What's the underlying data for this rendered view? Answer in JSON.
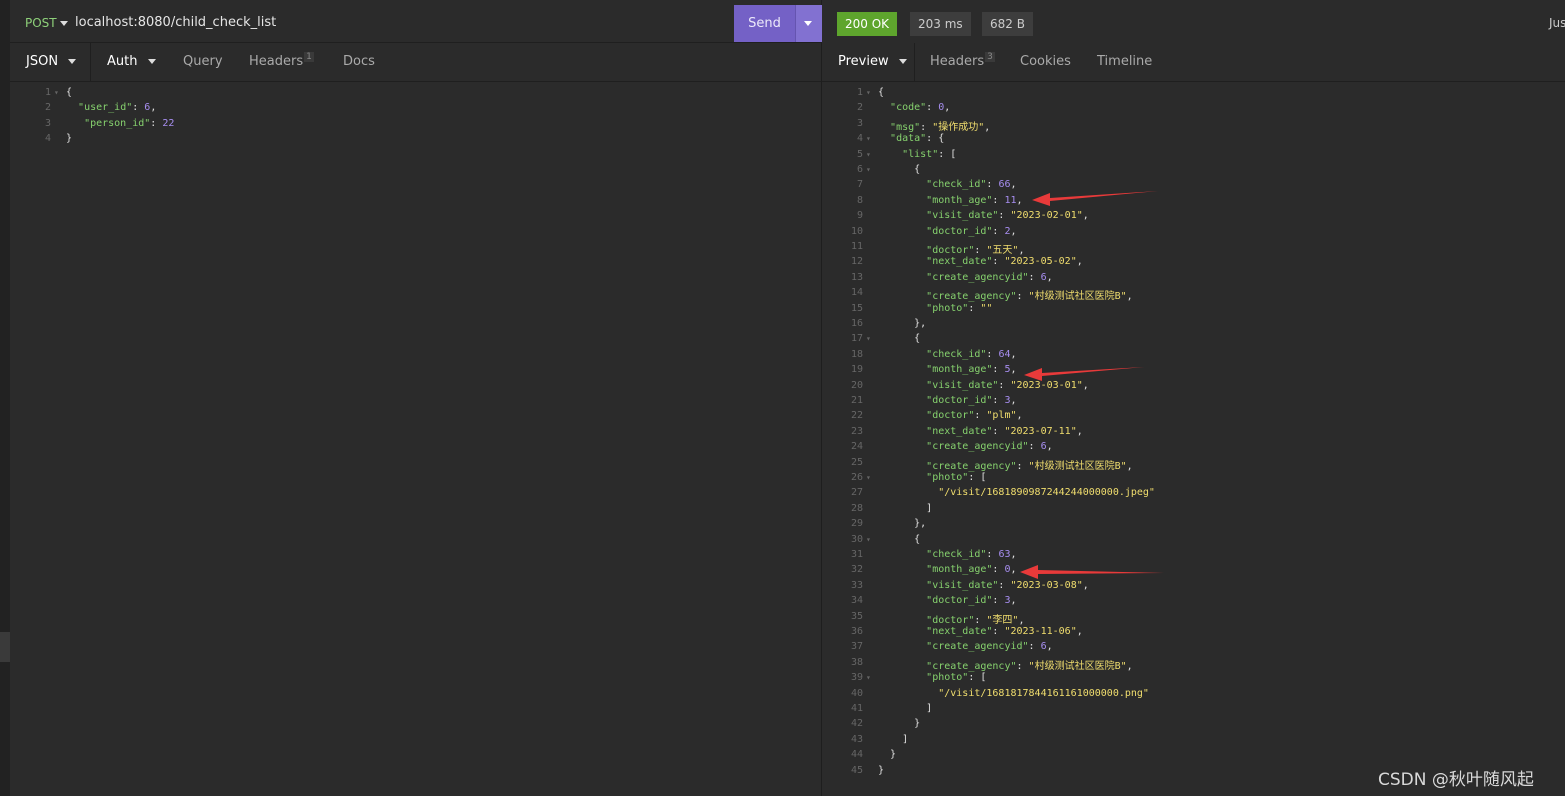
{
  "request": {
    "method": "POST",
    "url": "localhost:8080/child_check_list",
    "send_label": "Send",
    "tabs": {
      "json": "JSON",
      "auth": "Auth",
      "query": "Query",
      "headers": "Headers",
      "headers_count": "1",
      "docs": "Docs"
    },
    "body_lines": [
      "{",
      "  \"user_id\": 6,",
      "   \"person_id\": 22",
      "}"
    ]
  },
  "response": {
    "status": "200 OK",
    "time": "203 ms",
    "size": "682 B",
    "truncated_label": "Jus",
    "tabs": {
      "preview": "Preview",
      "headers": "Headers",
      "headers_count": "3",
      "cookies": "Cookies",
      "timeline": "Timeline"
    },
    "body_lines": [
      "{",
      "  \"code\": 0,",
      "  \"msg\": \"操作成功\",",
      "  \"data\": {",
      "    \"list\": [",
      "      {",
      "        \"check_id\": 66,",
      "        \"month_age\": 11,",
      "        \"visit_date\": \"2023-02-01\",",
      "        \"doctor_id\": 2,",
      "        \"doctor\": \"五天\",",
      "        \"next_date\": \"2023-05-02\",",
      "        \"create_agencyid\": 6,",
      "        \"create_agency\": \"村级测试社区医院B\",",
      "        \"photo\": \"\"",
      "      },",
      "      {",
      "        \"check_id\": 64,",
      "        \"month_age\": 5,",
      "        \"visit_date\": \"2023-03-01\",",
      "        \"doctor_id\": 3,",
      "        \"doctor\": \"plm\",",
      "        \"next_date\": \"2023-07-11\",",
      "        \"create_agencyid\": 6,",
      "        \"create_agency\": \"村级测试社区医院B\",",
      "        \"photo\": [",
      "          \"/visit/1681890987244244000000.jpeg\"",
      "        ]",
      "      },",
      "      {",
      "        \"check_id\": 63,",
      "        \"month_age\": 0,",
      "        \"visit_date\": \"2023-03-08\",",
      "        \"doctor_id\": 3,",
      "        \"doctor\": \"李四\",",
      "        \"next_date\": \"2023-11-06\",",
      "        \"create_agencyid\": 6,",
      "        \"create_agency\": \"村级测试社区医院B\",",
      "        \"photo\": [",
      "          \"/visit/1681817844161161000000.png\"",
      "        ]",
      "      }",
      "    ]",
      "  }",
      "}"
    ]
  },
  "watermark": "CSDN @秋叶随风起",
  "colors": {
    "key": "#86d16e",
    "number": "#a78ef0",
    "string": "#f1de6e",
    "send": "#7461c6",
    "ok": "#5ea52d",
    "annotation_arrow": "#e83a3a"
  }
}
